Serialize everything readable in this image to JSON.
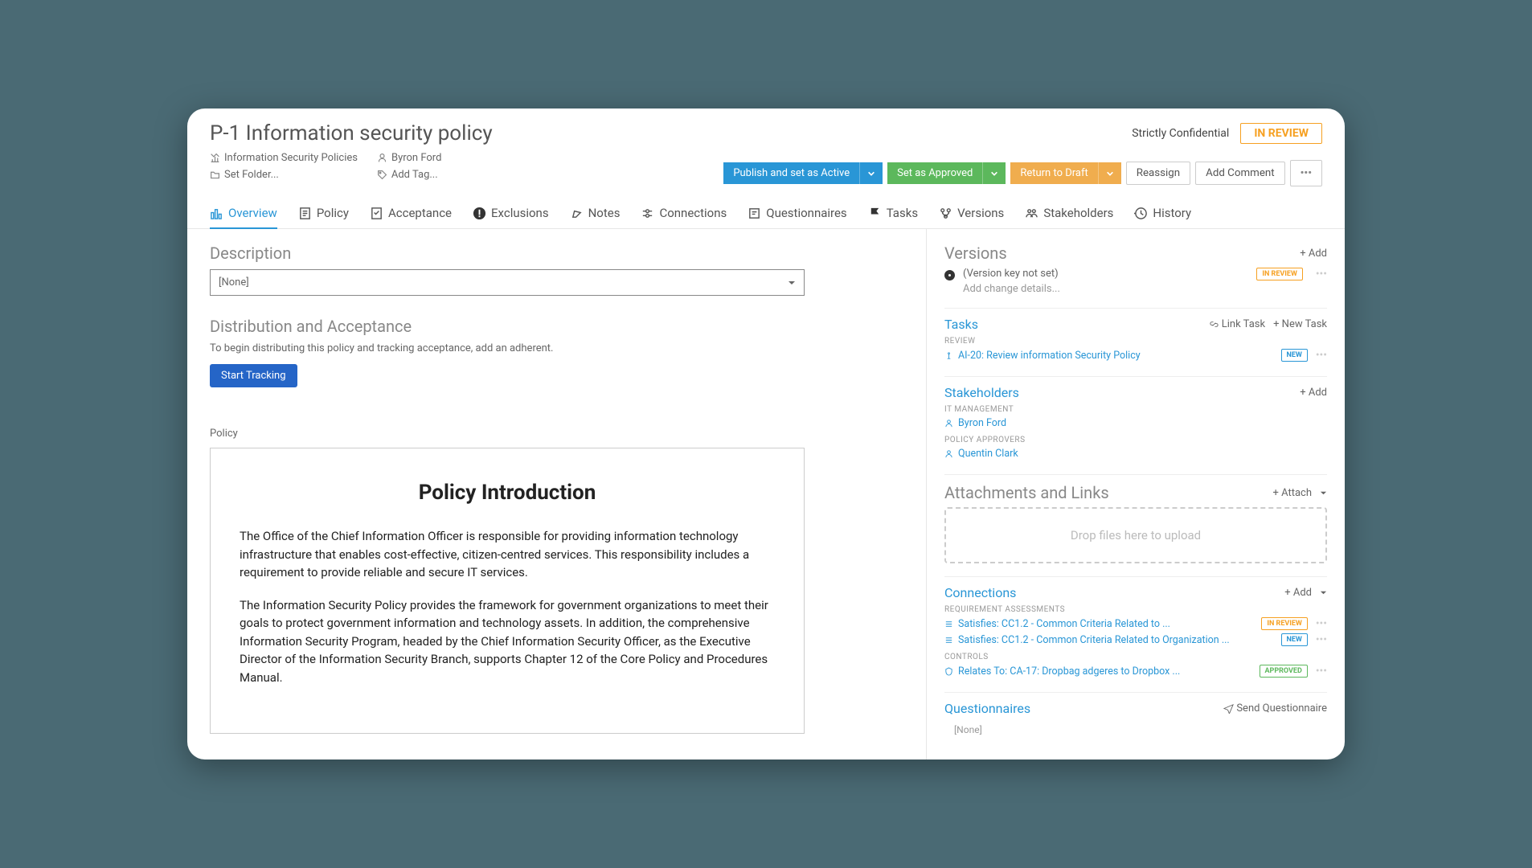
{
  "header": {
    "title": "P-1 Information security policy",
    "confidential": "Strictly Confidential",
    "status": "IN REVIEW",
    "category": "Information Security Policies",
    "owner": "Byron Ford",
    "folder": "Set Folder...",
    "tag": "Add Tag..."
  },
  "actions": {
    "publish": "Publish and set as Active",
    "approve": "Set as Approved",
    "draft": "Return to Draft",
    "reassign": "Reassign",
    "comment": "Add Comment"
  },
  "tabs": {
    "overview": "Overview",
    "policy": "Policy",
    "acceptance": "Acceptance",
    "exclusions": "Exclusions",
    "notes": "Notes",
    "connections": "Connections",
    "questionnaires": "Questionnaires",
    "tasks": "Tasks",
    "versions": "Versions",
    "stakeholders": "Stakeholders",
    "history": "History"
  },
  "main": {
    "desc_title": "Description",
    "desc_value": "[None]",
    "dist_title": "Distribution and Acceptance",
    "dist_text": "To begin distributing this policy and tracking acceptance, add an adherent.",
    "start_tracking": "Start Tracking",
    "policy_label": "Policy",
    "doc_title": "Policy Introduction",
    "doc_p1": "The Office of the Chief Information Officer is responsible for providing information technology infrastructure that enables cost-effective, citizen-centred services. This responsibility includes a requirement to provide reliable and secure IT services.",
    "doc_p2": "The Information Security Policy provides the framework for government organizations to meet their goals to protect government information and technology assets. In addition, the comprehensive Information Security Program, headed by the Chief Information Security Officer, as the Executive Director of the Information Security Branch, supports Chapter 12 of the Core Policy and Procedures Manual."
  },
  "side": {
    "versions": {
      "title": "Versions",
      "add": "+ Add",
      "item": "(Version key not set)",
      "sub": "Add change details...",
      "badge": "IN REVIEW"
    },
    "tasks": {
      "title": "Tasks",
      "link": "Link Task",
      "new": "+ New Task",
      "cat": "REVIEW",
      "item": "AI-20: Review information Security Policy",
      "badge": "NEW"
    },
    "stakeholders": {
      "title": "Stakeholders",
      "add": "+ Add",
      "cat1": "IT MANAGEMENT",
      "p1": "Byron Ford",
      "cat2": "POLICY APPROVERS",
      "p2": "Quentin Clark"
    },
    "attach": {
      "title": "Attachments and Links",
      "add": "+ Attach",
      "drop": "Drop files here to upload"
    },
    "conn": {
      "title": "Connections",
      "add": "+ Add",
      "cat1": "REQUIREMENT ASSESSMENTS",
      "i1": "Satisfies: CC1.2 - Common Criteria Related to ...",
      "b1": "IN REVIEW",
      "i2": "Satisfies: CC1.2 - Common Criteria Related to Organization ...",
      "b2": "NEW",
      "cat2": "CONTROLS",
      "i3": "Relates To: CA-17: Dropbag adgeres to Dropbox ...",
      "b3": "APPROVED"
    },
    "quest": {
      "title": "Questionnaires",
      "send": "Send Questionnaire",
      "none": "[None]"
    }
  }
}
